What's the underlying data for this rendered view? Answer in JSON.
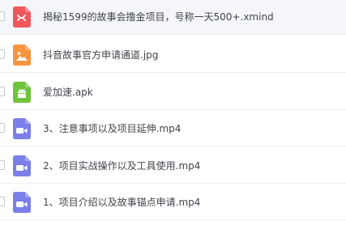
{
  "files": [
    {
      "name": "揭秘1599的故事会撸金项目，号称一天500+.xmind",
      "type": "xmind",
      "icon": "xmind-file-icon",
      "color": "#f0575c",
      "selected": true
    },
    {
      "name": "抖音故事官方申请通道.jpg",
      "type": "image",
      "icon": "image-file-icon",
      "color": "#f7953e",
      "selected": false
    },
    {
      "name": "爱加速.apk",
      "type": "apk",
      "icon": "android-apk-icon",
      "color": "#6fc43d",
      "selected": false
    },
    {
      "name": "3、注意事项以及项目延伸.mp4",
      "type": "video",
      "icon": "video-file-icon",
      "color": "#7b7fe8",
      "selected": false
    },
    {
      "name": "2、项目实战操作以及工具使用.mp4",
      "type": "video",
      "icon": "video-file-icon",
      "color": "#7b7fe8",
      "selected": false
    },
    {
      "name": "1、项目介绍以及故事锚点申请.mp4",
      "type": "video",
      "icon": "video-file-icon",
      "color": "#7b7fe8",
      "selected": false
    }
  ]
}
